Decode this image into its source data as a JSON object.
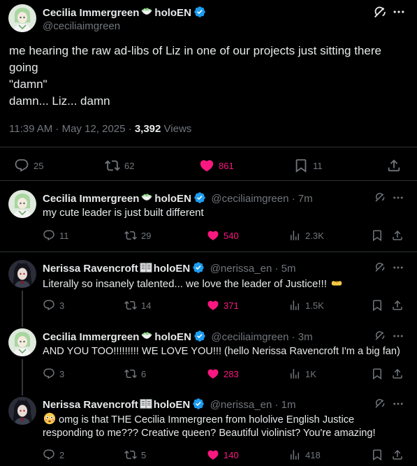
{
  "main": {
    "author_name": "Cecilia Immergreen",
    "author_suffix": "holoEN",
    "handle": "@ceciliaimgreen",
    "text_lines": [
      "me hearing the raw ad-libs of Liz in one of our projects just sitting there",
      "going",
      "\"damn\"",
      "damn... Liz... damn"
    ],
    "time": "11:39 AM · May 12, 2025 · ",
    "views_count": "3,392",
    "views_label": " Views",
    "replies": "25",
    "reposts": "62",
    "likes": "861",
    "bookmarks": "11"
  },
  "replies": [
    {
      "name": "Cecilia Immergreen",
      "suffix": "holoEN",
      "handle": "@ceciliaimgreen · 7m",
      "text": "my cute leader is just built different",
      "replies": "11",
      "reposts": "29",
      "likes": "540",
      "views": "2.3K"
    },
    {
      "name": "Nerissa Ravencroft",
      "suffix": "holoEN",
      "handle": "@nerissa_en · 5m",
      "text": "Literally so insanely talented... we love the leader of Justice!!!",
      "replies": "3",
      "reposts": "14",
      "likes": "371",
      "views": "1.5K"
    },
    {
      "name": "Cecilia Immergreen",
      "suffix": "holoEN",
      "handle": "@ceciliaimgreen · 3m",
      "text": "AND YOU TOO!!!!!!!!! WE LOVE YOU!!! (hello Nerissa Ravencroft I'm a big fan)",
      "replies": "3",
      "reposts": "6",
      "likes": "283",
      "views": "1K"
    },
    {
      "name": "Nerissa Ravencroft",
      "suffix": "holoEN",
      "handle": "@nerissa_en · 1m",
      "text_line1": "omg is that THE Cecilia Immergreen from hololive English Justice",
      "text_line2": "responding to me??? Creative queen? Beautiful violinist? You're amazing!",
      "replies": "2",
      "reposts": "5",
      "likes": "140",
      "views": "418"
    }
  ],
  "colors": {
    "background": "#000000",
    "text": "#e7e9ea",
    "muted": "#71767b",
    "like": "#f91880",
    "verified": "#1d9bf0",
    "divider": "#2f3336"
  }
}
